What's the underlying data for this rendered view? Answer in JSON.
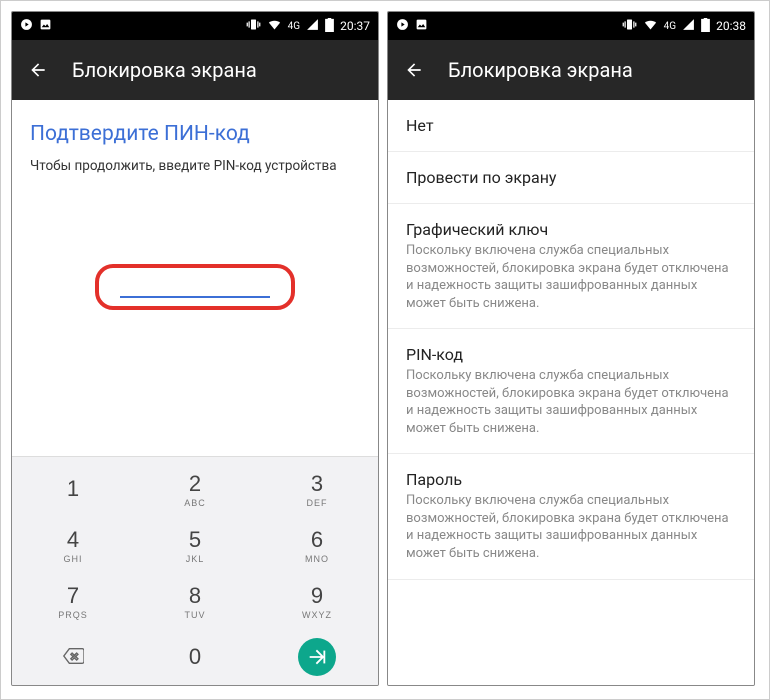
{
  "left": {
    "status_time": "20:37",
    "appbar_title": "Блокировка экрана",
    "pin_title": "Подтвердите ПИН-код",
    "pin_subtitle": "Чтобы продолжить, введите PIN-код устройства",
    "keys": [
      {
        "d": "1",
        "l": ""
      },
      {
        "d": "2",
        "l": "ABC"
      },
      {
        "d": "3",
        "l": "DEF"
      },
      {
        "d": "4",
        "l": "GHI"
      },
      {
        "d": "5",
        "l": "JKL"
      },
      {
        "d": "6",
        "l": "MNO"
      },
      {
        "d": "7",
        "l": "PRQS"
      },
      {
        "d": "8",
        "l": "TUV"
      },
      {
        "d": "9",
        "l": "WXYZ"
      },
      {
        "d": "0",
        "l": ""
      }
    ]
  },
  "right": {
    "status_time": "20:38",
    "appbar_title": "Блокировка экрана",
    "options": [
      {
        "title": "Нет",
        "desc": ""
      },
      {
        "title": "Провести по экрану",
        "desc": ""
      },
      {
        "title": "Графический ключ",
        "desc": "Поскольку включена служба специальных возможностей, блокировка экрана будет отключена и надежность защиты зашифрованных данных может быть снижена."
      },
      {
        "title": "PIN-код",
        "desc": "Поскольку включена служба специальных возможностей, блокировка экрана будет отключена и надежность защиты зашифрованных данных может быть снижена."
      },
      {
        "title": "Пароль",
        "desc": "Поскольку включена служба специальных возможностей, блокировка экрана будет отключена и надежность защиты зашифрованных данных может быть снижена."
      }
    ]
  }
}
